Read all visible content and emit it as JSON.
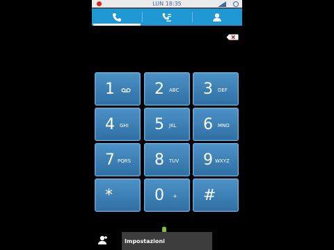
{
  "status_bar": {
    "time": "LUN 18:35"
  },
  "tabs": [
    {
      "icon": "phone-icon"
    },
    {
      "icon": "call-log-icon"
    },
    {
      "icon": "contacts-icon"
    }
  ],
  "keypad": [
    {
      "digit": "1",
      "letters": ""
    },
    {
      "digit": "2",
      "letters": "ABC"
    },
    {
      "digit": "3",
      "letters": "DEF"
    },
    {
      "digit": "4",
      "letters": "GHI"
    },
    {
      "digit": "5",
      "letters": "JKL"
    },
    {
      "digit": "6",
      "letters": "MNO"
    },
    {
      "digit": "7",
      "letters": "PQRS"
    },
    {
      "digit": "8",
      "letters": "TUV"
    },
    {
      "digit": "9",
      "letters": "WXYZ"
    },
    {
      "digit": "*",
      "letters": ""
    },
    {
      "digit": "0",
      "letters": "+"
    },
    {
      "digit": "#",
      "letters": ""
    }
  ],
  "menu": {
    "settings_label": "Impostazioni"
  },
  "colors": {
    "accent": "#1f97d3",
    "key": "#3d82b8",
    "recording": "#d9261c"
  }
}
